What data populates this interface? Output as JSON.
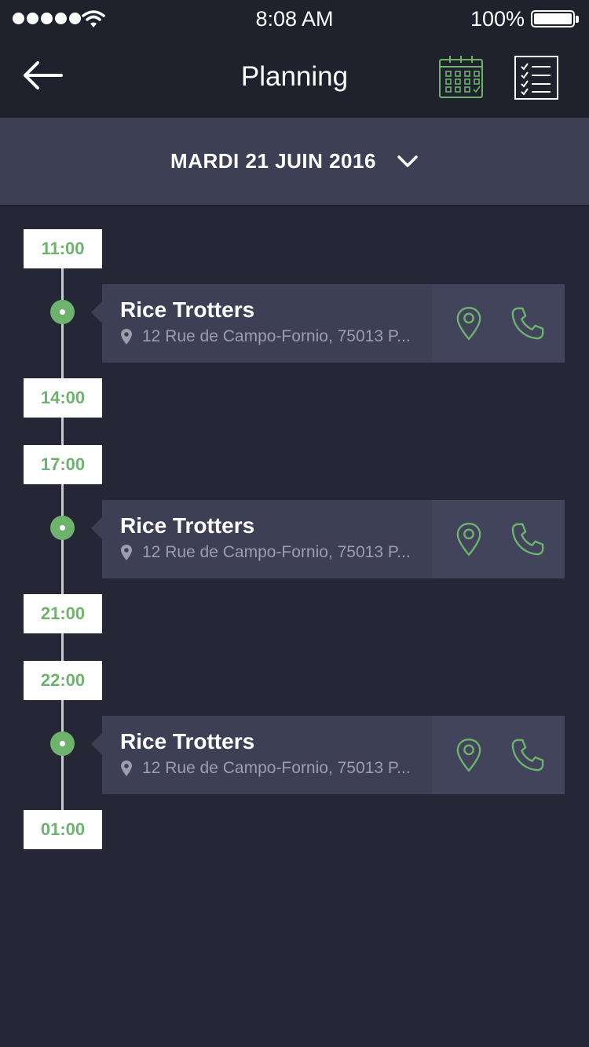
{
  "status_bar": {
    "time": "8:08 AM",
    "battery": "100%"
  },
  "nav": {
    "title": "Planning",
    "back_icon": "arrow-left-icon",
    "calendar_icon": "calendar-icon",
    "list_icon": "checklist-icon"
  },
  "date_selector": {
    "label": "MARDI 21 JUIN 2016",
    "icon": "chevron-down-icon"
  },
  "timeline": {
    "times": [
      "11:00",
      "14:00",
      "17:00",
      "21:00",
      "22:00",
      "01:00"
    ],
    "events": [
      {
        "title": "Rice Trotters",
        "address": "12 Rue de Campo-Fornio, 75013 P..."
      },
      {
        "title": "Rice Trotters",
        "address": "12 Rue de Campo-Fornio, 75013 P..."
      },
      {
        "title": "Rice Trotters",
        "address": "12 Rue de Campo-Fornio, 75013 P..."
      }
    ]
  },
  "colors": {
    "background": "#252736",
    "bar": "#1f212c",
    "card": "#3d3f55",
    "accent": "#6db36d",
    "secondary_text": "#9c9eac"
  }
}
